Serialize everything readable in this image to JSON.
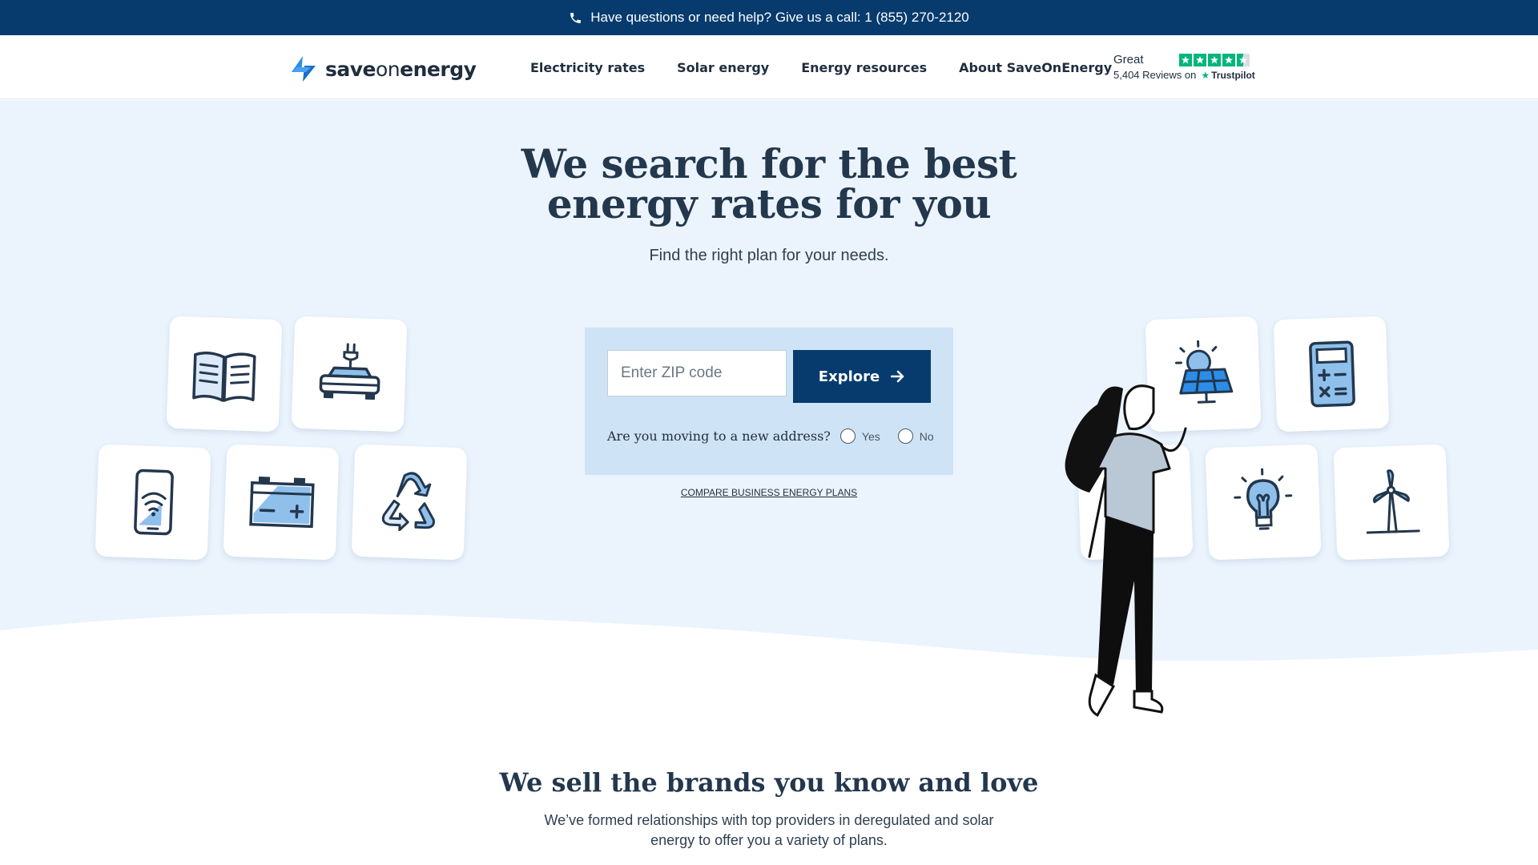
{
  "topbar": {
    "text": "Have questions or need help? Give us a call: 1 (855) 270-2120"
  },
  "header": {
    "logo": {
      "bold": "save",
      "light": "on",
      "bold2": "energy"
    },
    "nav": [
      "Electricity rates",
      "Solar energy",
      "Energy resources",
      "About SaveOnEnergy"
    ],
    "trustpilot": {
      "rating": "Great",
      "reviews": "5,404 Reviews on",
      "brand": "Trustpilot",
      "stars": 4.5
    }
  },
  "hero": {
    "headline": "We search for the best energy rates for you",
    "subhead": "Find the right plan for your needs.",
    "zip_placeholder": "Enter ZIP code",
    "explore_label": "Explore",
    "moving_question": "Are you moving to a new address?",
    "yes_label": "Yes",
    "no_label": "No",
    "business_link": "COMPARE BUSINESS ENERGY PLANS",
    "icons_left": [
      "book-icon",
      "electric-car-icon",
      "smartphone-wifi-icon",
      "battery-icon",
      "recycle-icon"
    ],
    "icons_right": [
      "solar-panel-icon",
      "calculator-icon",
      "light-bulb-icon",
      "wind-turbine-icon"
    ]
  },
  "brands": {
    "title": "We sell the brands you know and love",
    "text": "We’ve formed relationships with top providers in deregulated and solar energy to offer you a variety of plans."
  },
  "colors": {
    "navy": "#073b6e",
    "hero_bg": "#ebf4fd",
    "form_bg": "#cfe3f6",
    "accent_blue": "#2b8de8",
    "trustpilot_green": "#00b67a"
  }
}
